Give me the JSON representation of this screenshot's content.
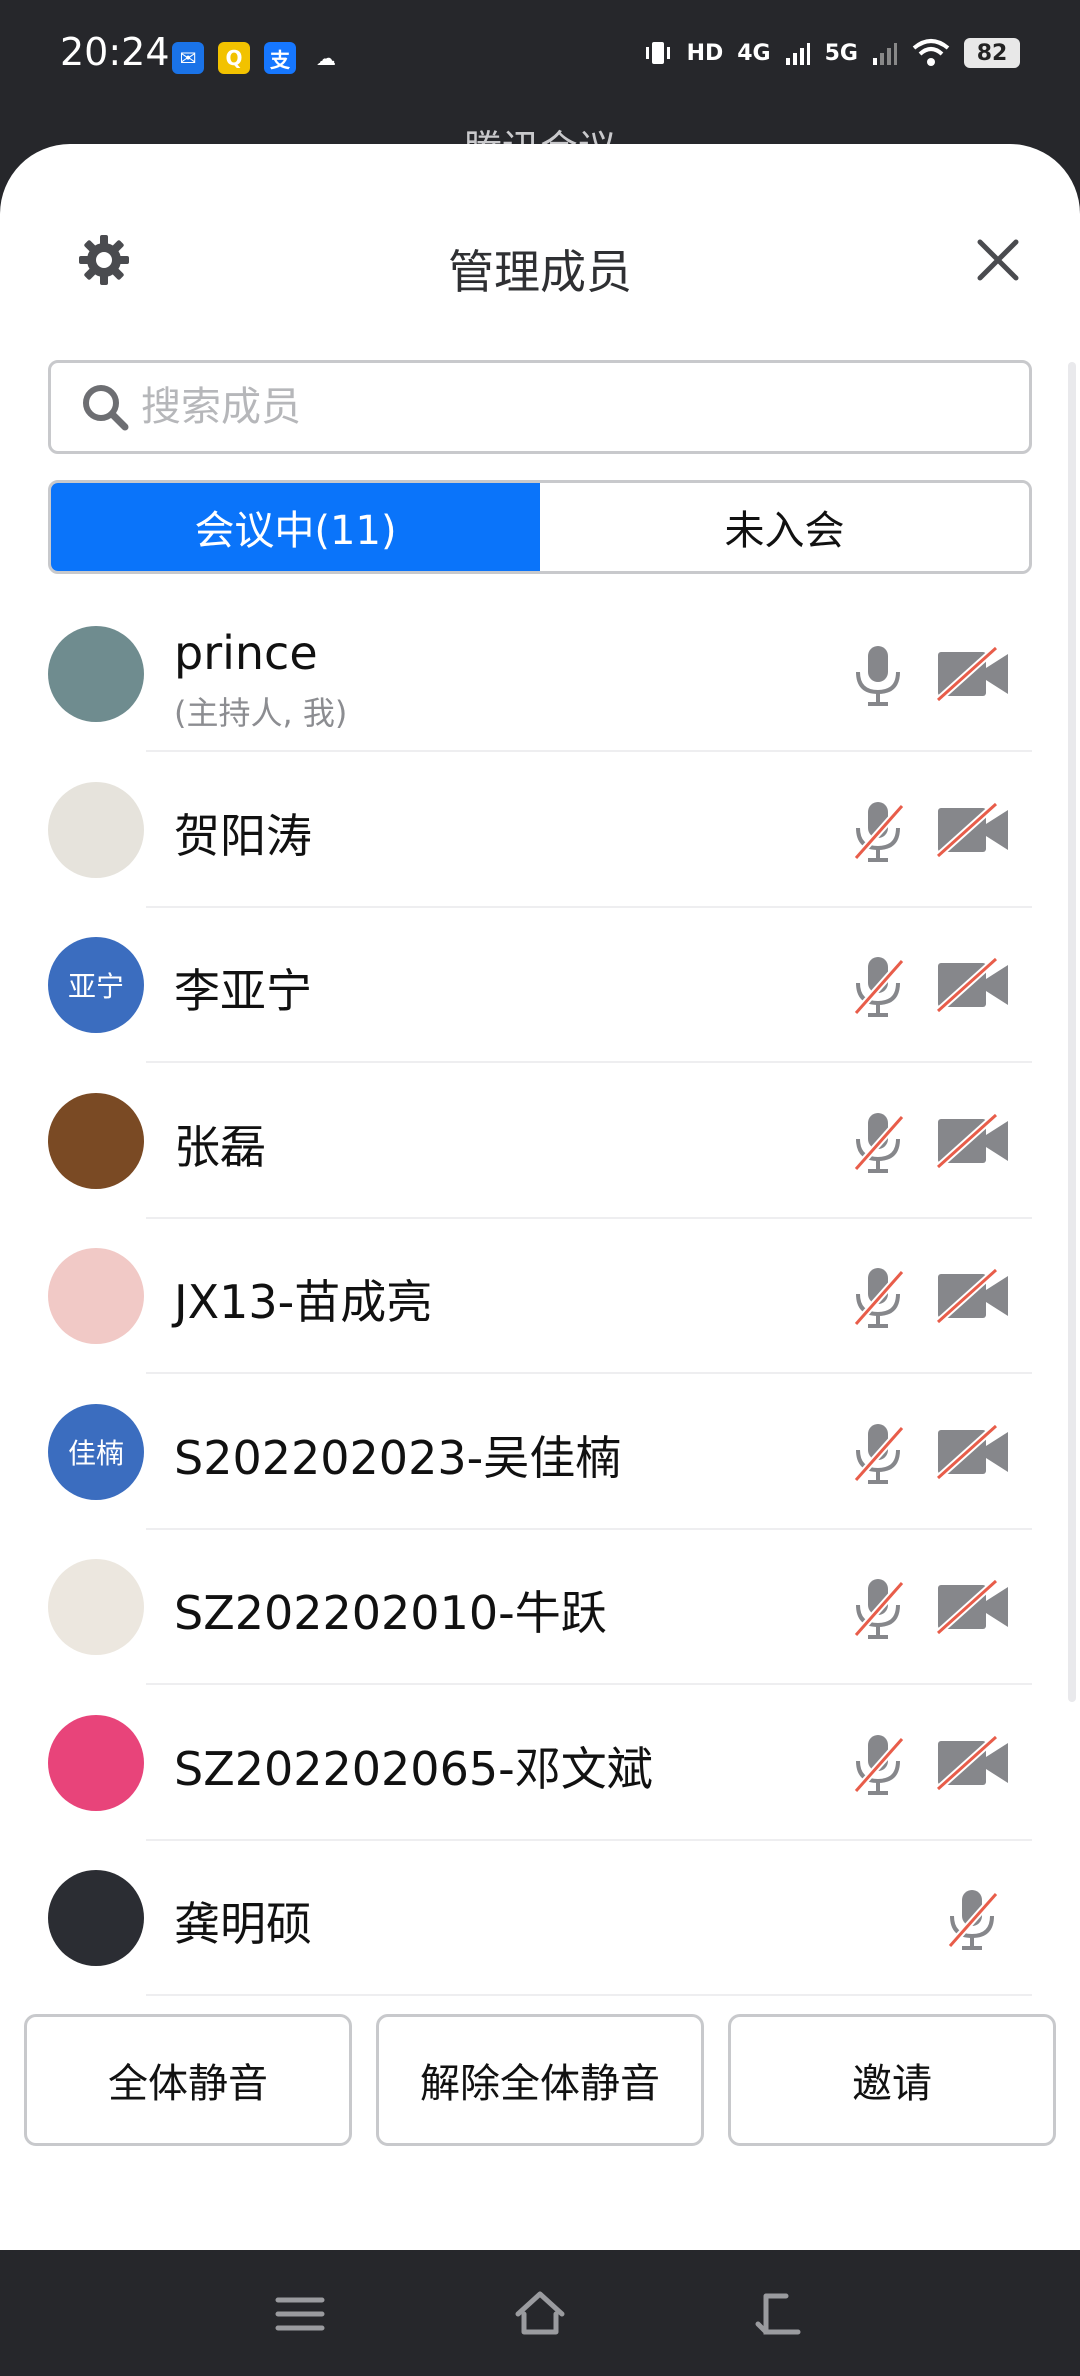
{
  "status_bar": {
    "time": "20:24",
    "apps": [
      {
        "icon": "mail-app-icon",
        "glyph": "✉",
        "color": "#1a73e8"
      },
      {
        "icon": "qq-app-icon",
        "glyph": "Q",
        "color": "#f2c200"
      },
      {
        "icon": "alipay-app-icon",
        "glyph": "支",
        "color": "#1677ff"
      },
      {
        "icon": "cloud-weather-icon",
        "glyph": "☁",
        "color": "transparent"
      }
    ],
    "hd": "HD",
    "net1": "4G",
    "net2": "5G",
    "battery": "82"
  },
  "behind_title": "腾讯会议",
  "sheet": {
    "title": "管理成员"
  },
  "search": {
    "placeholder": "搜索成员"
  },
  "tabs": {
    "in_meeting": "会议中(11)",
    "not_joined": "未入会"
  },
  "members": [
    {
      "name": "prince",
      "sub": "(主持人, 我)",
      "avatar_text": "",
      "avatar_color": "#6f8c8f",
      "mic_on": true,
      "cam_off": true,
      "cam_visible": true
    },
    {
      "name": "贺阳涛",
      "sub": "",
      "avatar_text": "",
      "avatar_color": "#e6e3dc",
      "mic_on": false,
      "cam_off": true,
      "cam_visible": true
    },
    {
      "name": "李亚宁",
      "sub": "",
      "avatar_text": "亚宁",
      "avatar_color": "#3b6dbf",
      "mic_on": false,
      "cam_off": true,
      "cam_visible": true
    },
    {
      "name": "张磊",
      "sub": "",
      "avatar_text": "",
      "avatar_color": "#7a4a24",
      "mic_on": false,
      "cam_off": true,
      "cam_visible": true
    },
    {
      "name": "JX13-苗成亮",
      "sub": "",
      "avatar_text": "",
      "avatar_color": "#f1c9c6",
      "mic_on": false,
      "cam_off": true,
      "cam_visible": true
    },
    {
      "name": "S202202023-吴佳楠",
      "sub": "",
      "avatar_text": "佳楠",
      "avatar_color": "#3b6dbf",
      "mic_on": false,
      "cam_off": true,
      "cam_visible": true
    },
    {
      "name": "SZ202202010-牛跃",
      "sub": "",
      "avatar_text": "",
      "avatar_color": "#ece7df",
      "mic_on": false,
      "cam_off": true,
      "cam_visible": true
    },
    {
      "name": "SZ202202065-邓文斌",
      "sub": "",
      "avatar_text": "",
      "avatar_color": "#e8447a",
      "mic_on": false,
      "cam_off": true,
      "cam_visible": true
    },
    {
      "name": "龚明硕",
      "sub": "",
      "avatar_text": "",
      "avatar_color": "#2b2d33",
      "mic_on": false,
      "cam_off": true,
      "cam_visible": false
    }
  ],
  "actions": {
    "mute_all": "全体静音",
    "unmute_all": "解除全体静音",
    "invite": "邀请"
  },
  "colors": {
    "accent": "#0a74fa",
    "muted_slash": "#e85d4a",
    "icon_gray": "#86878b"
  }
}
